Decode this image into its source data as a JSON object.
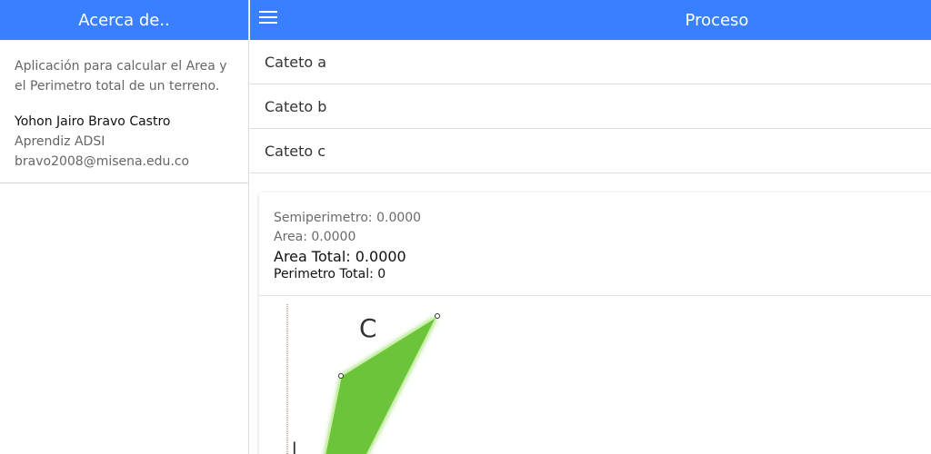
{
  "menu": {
    "title": "Acerca de..",
    "description": "Aplicación para calcular el Area y el Perimetro total de un terreno.",
    "author": "Yohon Jairo Bravo Castro",
    "role": "Aprendiz ADSI",
    "email": "bravo2008@misena.edu.co"
  },
  "header": {
    "title": "Proceso",
    "menu_icon": "menu-icon"
  },
  "inputs": [
    {
      "label": "Cateto a"
    },
    {
      "label": "Cateto b"
    },
    {
      "label": "Cateto c"
    }
  ],
  "results": {
    "semiperimetro": "Semiperimetro: 0.0000",
    "area": "Area: 0.0000",
    "area_total": "Area Total: 0.0000",
    "perimetro_total": "Perimetro Total: 0"
  },
  "figure": {
    "label_c": "C",
    "fill_color": "#6cc43a",
    "accent_color": "#3880ff"
  }
}
